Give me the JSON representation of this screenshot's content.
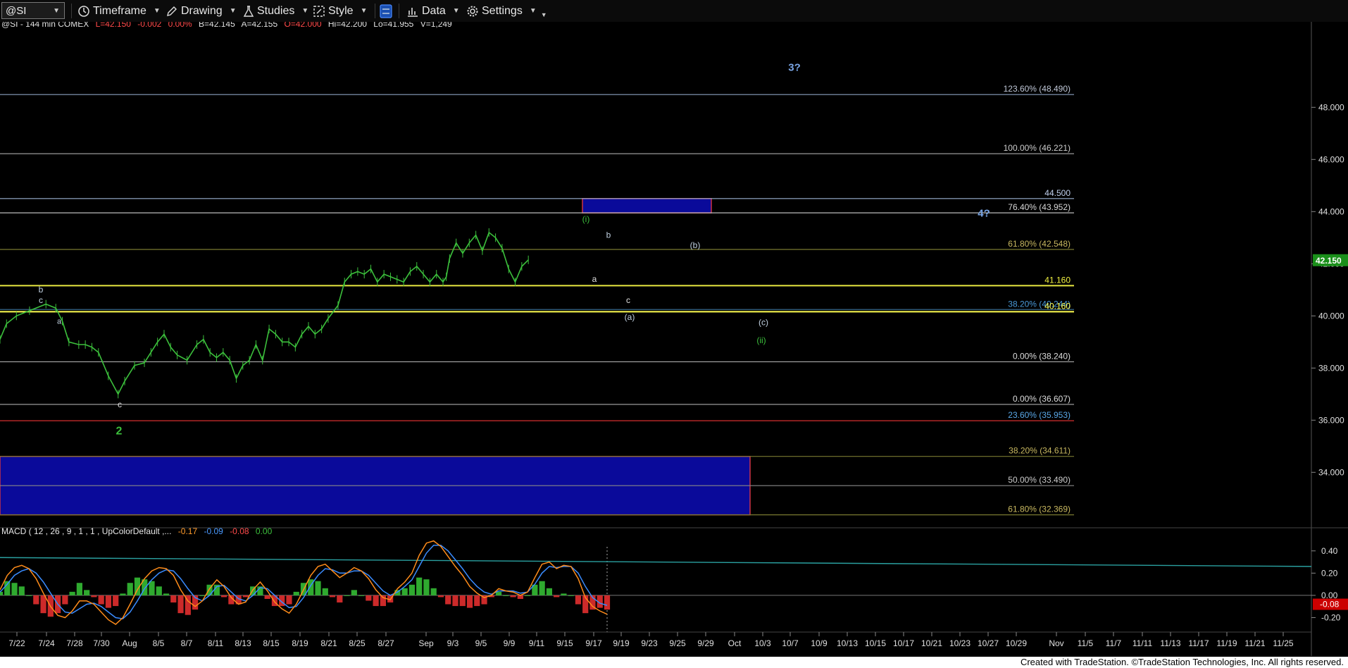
{
  "toolbar": {
    "symbol": "@SI",
    "timeframe_label": "Timeframe",
    "drawing_label": "Drawing",
    "studies_label": "Studies",
    "style_label": "Style",
    "data_label": "Data",
    "settings_label": "Settings"
  },
  "info_bar": {
    "symbol_info": "@SI - 144 min  COMEX",
    "last": "L=42.150",
    "change": "-0.002",
    "change_pct": "0.00%",
    "bid": "B=42.145",
    "ask": "A=42.155",
    "open": "O=42.000",
    "high": "Hi=42.200",
    "low": "Lo=41.955",
    "volume": "V=1,249"
  },
  "colors": {
    "price": "#3cc03c",
    "macd_line": "#ff8c1a",
    "signal_line": "#3a8cff",
    "hist_pos": "#2faa2f",
    "hist_neg": "#cc2a2a",
    "box_fill": "#0a0a9a",
    "box_border": "#cc3344",
    "last_price_bg": "#1a8f1a",
    "macd_last_bg": "#cc0000"
  },
  "chart_data": [
    {
      "type": "line",
      "price_axis": {
        "ticks": [
          "48.000",
          "46.000",
          "44.000",
          "42.000",
          "40.000",
          "38.000",
          "36.000",
          "34.000"
        ],
        "values": [
          48,
          46,
          44,
          42,
          40,
          38,
          36,
          34
        ],
        "ylim": [
          31.9,
          50.9
        ]
      },
      "date_ticks": [
        "7/22",
        "7/24",
        "7/28",
        "7/30",
        "Aug",
        "8/5",
        "8/7",
        "8/11",
        "8/13",
        "8/15",
        "8/19",
        "8/21",
        "8/25",
        "8/27",
        "Sep",
        "9/3",
        "9/5",
        "9/9",
        "9/11",
        "9/15",
        "9/17",
        "9/19",
        "9/23",
        "9/25",
        "9/29",
        "Oct",
        "10/3",
        "10/7",
        "10/9",
        "10/13",
        "10/15",
        "10/17",
        "10/21",
        "10/23",
        "10/27",
        "10/29",
        "Nov",
        "11/5",
        "11/7",
        "11/11",
        "11/13",
        "11/17",
        "11/19",
        "11/21",
        "11/25"
      ],
      "last_price": "42.150",
      "price_series": {
        "x": [
          0,
          2,
          5,
          9,
          14,
          17,
          19,
          21,
          24,
          26,
          28,
          30,
          33,
          36,
          38,
          41,
          44,
          46,
          48,
          50,
          52,
          54,
          57,
          60,
          62,
          64,
          66,
          68,
          70,
          72,
          74,
          76,
          78,
          80,
          82,
          84,
          86,
          88,
          90,
          92,
          94,
          96,
          98,
          100,
          103,
          105,
          107,
          109,
          111,
          113,
          115,
          117,
          119,
          121,
          123,
          125,
          127,
          129,
          131,
          133,
          135,
          136,
          137,
          139,
          141,
          143,
          145,
          147,
          149,
          151,
          153,
          155,
          157,
          159,
          161,
          163,
          165,
          167,
          169,
          171,
          173,
          175,
          177,
          179,
          181,
          183,
          185
        ],
        "y": [
          39.1,
          39.7,
          40.0,
          40.2,
          40.45,
          40.3,
          39.8,
          39.0,
          38.9,
          38.9,
          38.8,
          38.6,
          37.7,
          37.0,
          37.5,
          38.1,
          38.2,
          38.6,
          39.0,
          39.3,
          38.8,
          38.5,
          38.3,
          38.9,
          39.1,
          38.6,
          38.4,
          38.6,
          38.3,
          37.6,
          38.1,
          38.3,
          38.9,
          38.3,
          39.5,
          39.3,
          39.0,
          39.0,
          38.8,
          39.3,
          39.6,
          39.3,
          39.5,
          39.9,
          40.4,
          41.3,
          41.6,
          41.7,
          41.6,
          41.8,
          41.3,
          41.6,
          41.5,
          41.4,
          41.3,
          41.7,
          41.9,
          41.6,
          41.3,
          41.6,
          41.3,
          41.5,
          42.2,
          42.8,
          42.4,
          42.8,
          43.1,
          42.5,
          43.2,
          43.0,
          42.6,
          41.8,
          41.3,
          41.9,
          42.15
        ]
      },
      "fib_levels": [
        {
          "label": "123.60% (48.490)",
          "value": 48.49
        },
        {
          "label": "100.00% (46.221)",
          "value": 46.221
        },
        {
          "label": "44.500",
          "value": 44.5
        },
        {
          "label": "76.40% (43.952)",
          "value": 43.952
        },
        {
          "label": "61.80% (42.548)",
          "value": 42.548
        },
        {
          "label": "41.160",
          "value": 41.16
        },
        {
          "label": "38.20% (40.244)",
          "value": 40.244
        },
        {
          "label": "40.160",
          "value": 40.16
        },
        {
          "label": "0.00% (38.240)",
          "value": 38.24
        },
        {
          "label": "0.00% (36.607)",
          "value": 36.607
        },
        {
          "label": "23.60% (35.953)",
          "value": 35.98
        },
        {
          "label": "38.20% (34.611)",
          "value": 34.611
        },
        {
          "label": "50.00% (33.490)",
          "value": 33.49
        },
        {
          "label": "61.80% (32.369)",
          "value": 32.369
        }
      ],
      "wave_labels": [
        "3?",
        "4?",
        "(i)",
        "b",
        "a",
        "c",
        "(a)",
        "(b)",
        "(c)",
        "(ii)",
        "b",
        "c",
        "c",
        "2",
        "a"
      ]
    },
    {
      "type": "line",
      "title": "MACD ( 12 , 26 , 9 , 1 , 1 , UpColorDefault ,...",
      "values_text": [
        "-0.17",
        "-0.09",
        "-0.08",
        "0.00"
      ],
      "axis_ticks": [
        "0.40",
        "0.20",
        "0.00",
        "-0.20"
      ],
      "axis_values": [
        0.4,
        0.2,
        0.0,
        -0.2
      ],
      "ylim": [
        -0.33,
        0.5
      ],
      "last_value": "-0.08",
      "macd": [
        0.05,
        0.18,
        0.25,
        0.27,
        0.24,
        0.15,
        0.02,
        -0.1,
        -0.18,
        -0.2,
        -0.14,
        -0.05,
        -0.05,
        -0.08,
        -0.15,
        -0.22,
        -0.26,
        -0.2,
        -0.08,
        0.05,
        0.15,
        0.22,
        0.25,
        0.24,
        0.18,
        0.05,
        -0.05,
        -0.1,
        -0.05,
        0.06,
        0.14,
        0.08,
        -0.02,
        -0.08,
        -0.06,
        0.05,
        0.12,
        0.04,
        -0.06,
        -0.12,
        -0.16,
        -0.08,
        0.05,
        0.18,
        0.26,
        0.28,
        0.22,
        0.16,
        0.2,
        0.25,
        0.22,
        0.15,
        0.05,
        -0.02,
        -0.04,
        0.06,
        0.12,
        0.2,
        0.36,
        0.47,
        0.49,
        0.44,
        0.35,
        0.26,
        0.18,
        0.08,
        0.02,
        -0.02,
        0.0,
        0.06,
        0.04,
        0.03,
        0.0,
        0.03,
        0.16,
        0.28,
        0.3,
        0.24,
        0.27,
        0.26,
        0.15,
        -0.02,
        -0.1,
        -0.14,
        -0.17
      ],
      "signal": [
        0.03,
        0.1,
        0.18,
        0.22,
        0.24,
        0.2,
        0.12,
        0.02,
        -0.08,
        -0.15,
        -0.16,
        -0.12,
        -0.08,
        -0.07,
        -0.1,
        -0.15,
        -0.2,
        -0.21,
        -0.15,
        -0.05,
        0.06,
        0.14,
        0.2,
        0.23,
        0.22,
        0.15,
        0.06,
        -0.02,
        -0.05,
        0.0,
        0.08,
        0.09,
        0.03,
        -0.03,
        -0.05,
        0.0,
        0.07,
        0.06,
        0.0,
        -0.06,
        -0.11,
        -0.1,
        -0.02,
        0.09,
        0.18,
        0.24,
        0.23,
        0.2,
        0.2,
        0.22,
        0.22,
        0.18,
        0.11,
        0.04,
        0.0,
        0.03,
        0.08,
        0.14,
        0.26,
        0.38,
        0.45,
        0.45,
        0.4,
        0.32,
        0.24,
        0.15,
        0.08,
        0.03,
        0.01,
        0.04,
        0.04,
        0.04,
        0.02,
        0.03,
        0.1,
        0.2,
        0.26,
        0.25,
        0.26,
        0.26,
        0.2,
        0.08,
        -0.02,
        -0.07,
        -0.09
      ],
      "zero_line": 0.0
    }
  ],
  "footer": {
    "credit": "Created with TradeStation. ©TradeStation Technologies, Inc. All rights reserved."
  }
}
